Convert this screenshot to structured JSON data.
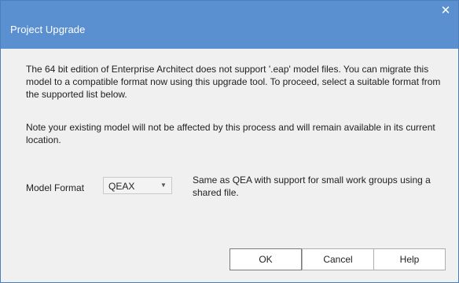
{
  "window": {
    "title": "Project Upgrade",
    "close_glyph": "✕"
  },
  "message": {
    "paragraph1": "The 64 bit edition of Enterprise Architect does not support '.eap' model files. You can migrate this model to a compatible format now using this upgrade tool. To proceed, select a suitable format from the supported list below.",
    "paragraph2": "Note your existing model will not be affected by this process and will remain available in its current location."
  },
  "model_format": {
    "label": "Model Format",
    "selected": "QEAX",
    "arrow_icon": "chevron-down-icon",
    "description": "Same as QEA with support for small work groups using a shared file."
  },
  "buttons": {
    "ok": "OK",
    "cancel": "Cancel",
    "help": "Help"
  },
  "colors": {
    "titlebar": "#5a8fd0",
    "dialog_background": "#f0f0f0"
  }
}
